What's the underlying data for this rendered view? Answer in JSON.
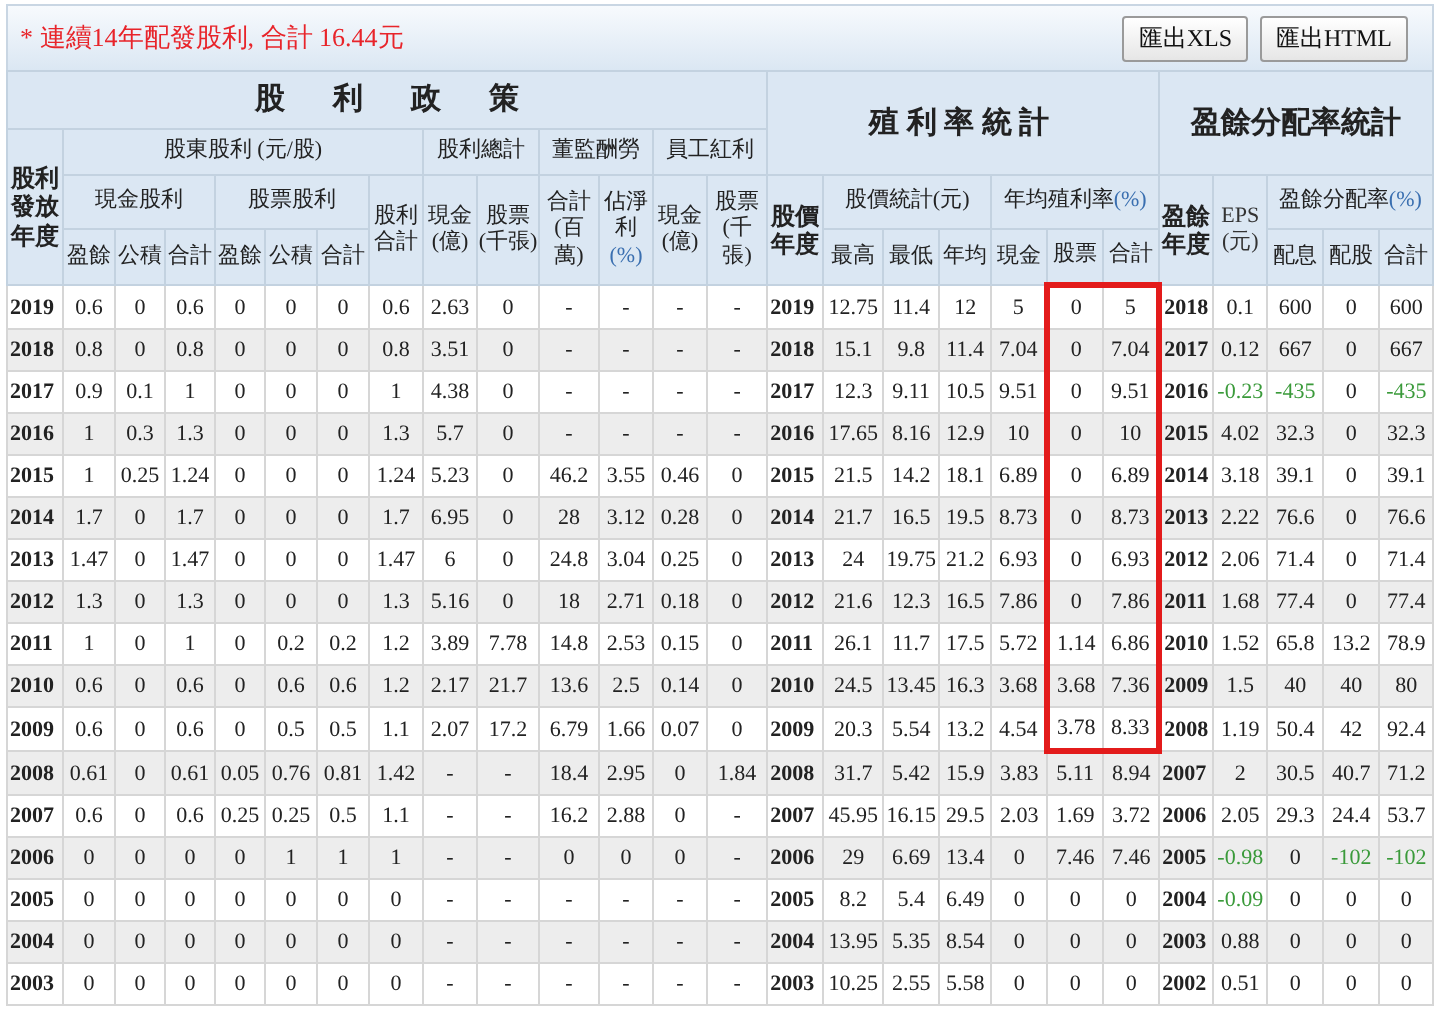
{
  "notice": "* 連續14年配發股利, 合計 16.44元",
  "buttons": [
    "匯出XLS",
    "匯出HTML"
  ],
  "header": {
    "dividend_policy": "股利政策",
    "yield_stats": "殖利率統計",
    "payout_stats": "盈餘分配率統計",
    "dividend_year": "股利發放年度",
    "shareholder_dividend": "股東股利 (元/股)",
    "dividend_total": "股利總計",
    "director_pay": "董監酬勞",
    "employee_bonus": "員工紅利",
    "cash_dividend": "現金股利",
    "stock_dividend": "股票股利",
    "dividend_sum": "股利合計",
    "total_cash": "現金(億)",
    "total_stock": "股票(千張)",
    "director_sum": "合計(百萬)",
    "director_share": {
      "label": "佔淨利",
      "unit": "(%)"
    },
    "employee_cash": "現金(億)",
    "employee_stock": "股票(千張)",
    "price_year": "股價年度",
    "price_stats": "股價統計(元)",
    "avg_yield": {
      "label": "年均殖利率",
      "unit": "(%)"
    },
    "earnings_year": "盈餘年度",
    "eps": "EPS(元)",
    "payout_ratio": {
      "label": "盈餘分配率",
      "unit": "(%)"
    },
    "sub_cash": [
      "盈餘",
      "公積",
      "合計"
    ],
    "sub_stock": [
      "盈餘",
      "公積",
      "合計"
    ],
    "sub_price": [
      "最高",
      "最低",
      "年均"
    ],
    "sub_yield": [
      "現金",
      "股票",
      "合計"
    ],
    "sub_payout": [
      "配息",
      "配股",
      "合計"
    ]
  },
  "rows": [
    {
      "year": "2019",
      "dividend": [
        "0.6",
        "0",
        "0.6",
        "0",
        "0",
        "0",
        "0.6",
        "2.63",
        "0",
        "-",
        "-",
        "-",
        "-"
      ],
      "price_year": "2019",
      "yield": [
        "12.75",
        "11.4",
        "12",
        "5",
        "0",
        "5"
      ],
      "marked": true,
      "earnings_year": "2018",
      "payout": [
        "0.1",
        "600",
        "0",
        "600"
      ],
      "negative": [
        false,
        false,
        false,
        false
      ]
    },
    {
      "year": "2018",
      "dividend": [
        "0.8",
        "0",
        "0.8",
        "0",
        "0",
        "0",
        "0.8",
        "3.51",
        "0",
        "-",
        "-",
        "-",
        "-"
      ],
      "price_year": "2018",
      "yield": [
        "15.1",
        "9.8",
        "11.4",
        "7.04",
        "0",
        "7.04"
      ],
      "marked": true,
      "earnings_year": "2017",
      "payout": [
        "0.12",
        "667",
        "0",
        "667"
      ],
      "negative": [
        false,
        false,
        false,
        false
      ]
    },
    {
      "year": "2017",
      "dividend": [
        "0.9",
        "0.1",
        "1",
        "0",
        "0",
        "0",
        "1",
        "4.38",
        "0",
        "-",
        "-",
        "-",
        "-"
      ],
      "price_year": "2017",
      "yield": [
        "12.3",
        "9.11",
        "10.5",
        "9.51",
        "0",
        "9.51"
      ],
      "marked": true,
      "earnings_year": "2016",
      "payout": [
        "-0.23",
        "-435",
        "0",
        "-435"
      ],
      "negative": [
        true,
        true,
        false,
        true
      ]
    },
    {
      "year": "2016",
      "dividend": [
        "1",
        "0.3",
        "1.3",
        "0",
        "0",
        "0",
        "1.3",
        "5.7",
        "0",
        "-",
        "-",
        "-",
        "-"
      ],
      "price_year": "2016",
      "yield": [
        "17.65",
        "8.16",
        "12.9",
        "10",
        "0",
        "10"
      ],
      "marked": true,
      "earnings_year": "2015",
      "payout": [
        "4.02",
        "32.3",
        "0",
        "32.3"
      ],
      "negative": [
        false,
        false,
        false,
        false
      ]
    },
    {
      "year": "2015",
      "dividend": [
        "1",
        "0.25",
        "1.24",
        "0",
        "0",
        "0",
        "1.24",
        "5.23",
        "0",
        "46.2",
        "3.55",
        "0.46",
        "0"
      ],
      "price_year": "2015",
      "yield": [
        "21.5",
        "14.2",
        "18.1",
        "6.89",
        "0",
        "6.89"
      ],
      "marked": true,
      "earnings_year": "2014",
      "payout": [
        "3.18",
        "39.1",
        "0",
        "39.1"
      ],
      "negative": [
        false,
        false,
        false,
        false
      ]
    },
    {
      "year": "2014",
      "dividend": [
        "1.7",
        "0",
        "1.7",
        "0",
        "0",
        "0",
        "1.7",
        "6.95",
        "0",
        "28",
        "3.12",
        "0.28",
        "0"
      ],
      "price_year": "2014",
      "yield": [
        "21.7",
        "16.5",
        "19.5",
        "8.73",
        "0",
        "8.73"
      ],
      "marked": true,
      "earnings_year": "2013",
      "payout": [
        "2.22",
        "76.6",
        "0",
        "76.6"
      ],
      "negative": [
        false,
        false,
        false,
        false
      ]
    },
    {
      "year": "2013",
      "dividend": [
        "1.47",
        "0",
        "1.47",
        "0",
        "0",
        "0",
        "1.47",
        "6",
        "0",
        "24.8",
        "3.04",
        "0.25",
        "0"
      ],
      "price_year": "2013",
      "yield": [
        "24",
        "19.75",
        "21.2",
        "6.93",
        "0",
        "6.93"
      ],
      "marked": true,
      "earnings_year": "2012",
      "payout": [
        "2.06",
        "71.4",
        "0",
        "71.4"
      ],
      "negative": [
        false,
        false,
        false,
        false
      ]
    },
    {
      "year": "2012",
      "dividend": [
        "1.3",
        "0",
        "1.3",
        "0",
        "0",
        "0",
        "1.3",
        "5.16",
        "0",
        "18",
        "2.71",
        "0.18",
        "0"
      ],
      "price_year": "2012",
      "yield": [
        "21.6",
        "12.3",
        "16.5",
        "7.86",
        "0",
        "7.86"
      ],
      "marked": true,
      "earnings_year": "2011",
      "payout": [
        "1.68",
        "77.4",
        "0",
        "77.4"
      ],
      "negative": [
        false,
        false,
        false,
        false
      ]
    },
    {
      "year": "2011",
      "dividend": [
        "1",
        "0",
        "1",
        "0",
        "0.2",
        "0.2",
        "1.2",
        "3.89",
        "7.78",
        "14.8",
        "2.53",
        "0.15",
        "0"
      ],
      "price_year": "2011",
      "yield": [
        "26.1",
        "11.7",
        "17.5",
        "5.72",
        "1.14",
        "6.86"
      ],
      "marked": true,
      "earnings_year": "2010",
      "payout": [
        "1.52",
        "65.8",
        "13.2",
        "78.9"
      ],
      "negative": [
        false,
        false,
        false,
        false
      ]
    },
    {
      "year": "2010",
      "dividend": [
        "0.6",
        "0",
        "0.6",
        "0",
        "0.6",
        "0.6",
        "1.2",
        "2.17",
        "21.7",
        "13.6",
        "2.5",
        "0.14",
        "0"
      ],
      "price_year": "2010",
      "yield": [
        "24.5",
        "13.45",
        "16.3",
        "3.68",
        "3.68",
        "7.36"
      ],
      "marked": true,
      "earnings_year": "2009",
      "payout": [
        "1.5",
        "40",
        "40",
        "80"
      ],
      "negative": [
        false,
        false,
        false,
        false
      ]
    },
    {
      "year": "2009",
      "dividend": [
        "0.6",
        "0",
        "0.6",
        "0",
        "0.5",
        "0.5",
        "1.1",
        "2.07",
        "17.2",
        "6.79",
        "1.66",
        "0.07",
        "0"
      ],
      "price_year": "2009",
      "yield": [
        "20.3",
        "5.54",
        "13.2",
        "4.54",
        "3.78",
        "8.33"
      ],
      "marked": true,
      "earnings_year": "2008",
      "payout": [
        "1.19",
        "50.4",
        "42",
        "92.4"
      ],
      "negative": [
        false,
        false,
        false,
        false
      ]
    },
    {
      "year": "2008",
      "dividend": [
        "0.61",
        "0",
        "0.61",
        "0.05",
        "0.76",
        "0.81",
        "1.42",
        "-",
        "-",
        "18.4",
        "2.95",
        "0",
        "1.84"
      ],
      "price_year": "2008",
      "yield": [
        "31.7",
        "5.42",
        "15.9",
        "3.83",
        "5.11",
        "8.94"
      ],
      "marked": false,
      "earnings_year": "2007",
      "payout": [
        "2",
        "30.5",
        "40.7",
        "71.2"
      ],
      "negative": [
        false,
        false,
        false,
        false
      ]
    },
    {
      "year": "2007",
      "dividend": [
        "0.6",
        "0",
        "0.6",
        "0.25",
        "0.25",
        "0.5",
        "1.1",
        "-",
        "-",
        "16.2",
        "2.88",
        "0",
        "-"
      ],
      "price_year": "2007",
      "yield": [
        "45.95",
        "16.15",
        "29.5",
        "2.03",
        "1.69",
        "3.72"
      ],
      "marked": false,
      "earnings_year": "2006",
      "payout": [
        "2.05",
        "29.3",
        "24.4",
        "53.7"
      ],
      "negative": [
        false,
        false,
        false,
        false
      ]
    },
    {
      "year": "2006",
      "dividend": [
        "0",
        "0",
        "0",
        "0",
        "1",
        "1",
        "1",
        "-",
        "-",
        "0",
        "0",
        "0",
        "-"
      ],
      "price_year": "2006",
      "yield": [
        "29",
        "6.69",
        "13.4",
        "0",
        "7.46",
        "7.46"
      ],
      "marked": false,
      "earnings_year": "2005",
      "payout": [
        "-0.98",
        "0",
        "-102",
        "-102"
      ],
      "negative": [
        true,
        false,
        true,
        true
      ]
    },
    {
      "year": "2005",
      "dividend": [
        "0",
        "0",
        "0",
        "0",
        "0",
        "0",
        "0",
        "-",
        "-",
        "-",
        "-",
        "-",
        "-"
      ],
      "price_year": "2005",
      "yield": [
        "8.2",
        "5.4",
        "6.49",
        "0",
        "0",
        "0"
      ],
      "marked": false,
      "earnings_year": "2004",
      "payout": [
        "-0.09",
        "0",
        "0",
        "0"
      ],
      "negative": [
        true,
        false,
        false,
        false
      ]
    },
    {
      "year": "2004",
      "dividend": [
        "0",
        "0",
        "0",
        "0",
        "0",
        "0",
        "0",
        "-",
        "-",
        "-",
        "-",
        "-",
        "-"
      ],
      "price_year": "2004",
      "yield": [
        "13.95",
        "5.35",
        "8.54",
        "0",
        "0",
        "0"
      ],
      "marked": false,
      "earnings_year": "2003",
      "payout": [
        "0.88",
        "0",
        "0",
        "0"
      ],
      "negative": [
        false,
        false,
        false,
        false
      ]
    },
    {
      "year": "2003",
      "dividend": [
        "0",
        "0",
        "0",
        "0",
        "0",
        "0",
        "0",
        "-",
        "-",
        "-",
        "-",
        "-",
        "-"
      ],
      "price_year": "2003",
      "yield": [
        "10.25",
        "2.55",
        "5.58",
        "0",
        "0",
        "0"
      ],
      "marked": false,
      "earnings_year": "2002",
      "payout": [
        "0.51",
        "0",
        "0",
        "0"
      ],
      "negative": [
        false,
        false,
        false,
        false
      ]
    }
  ]
}
